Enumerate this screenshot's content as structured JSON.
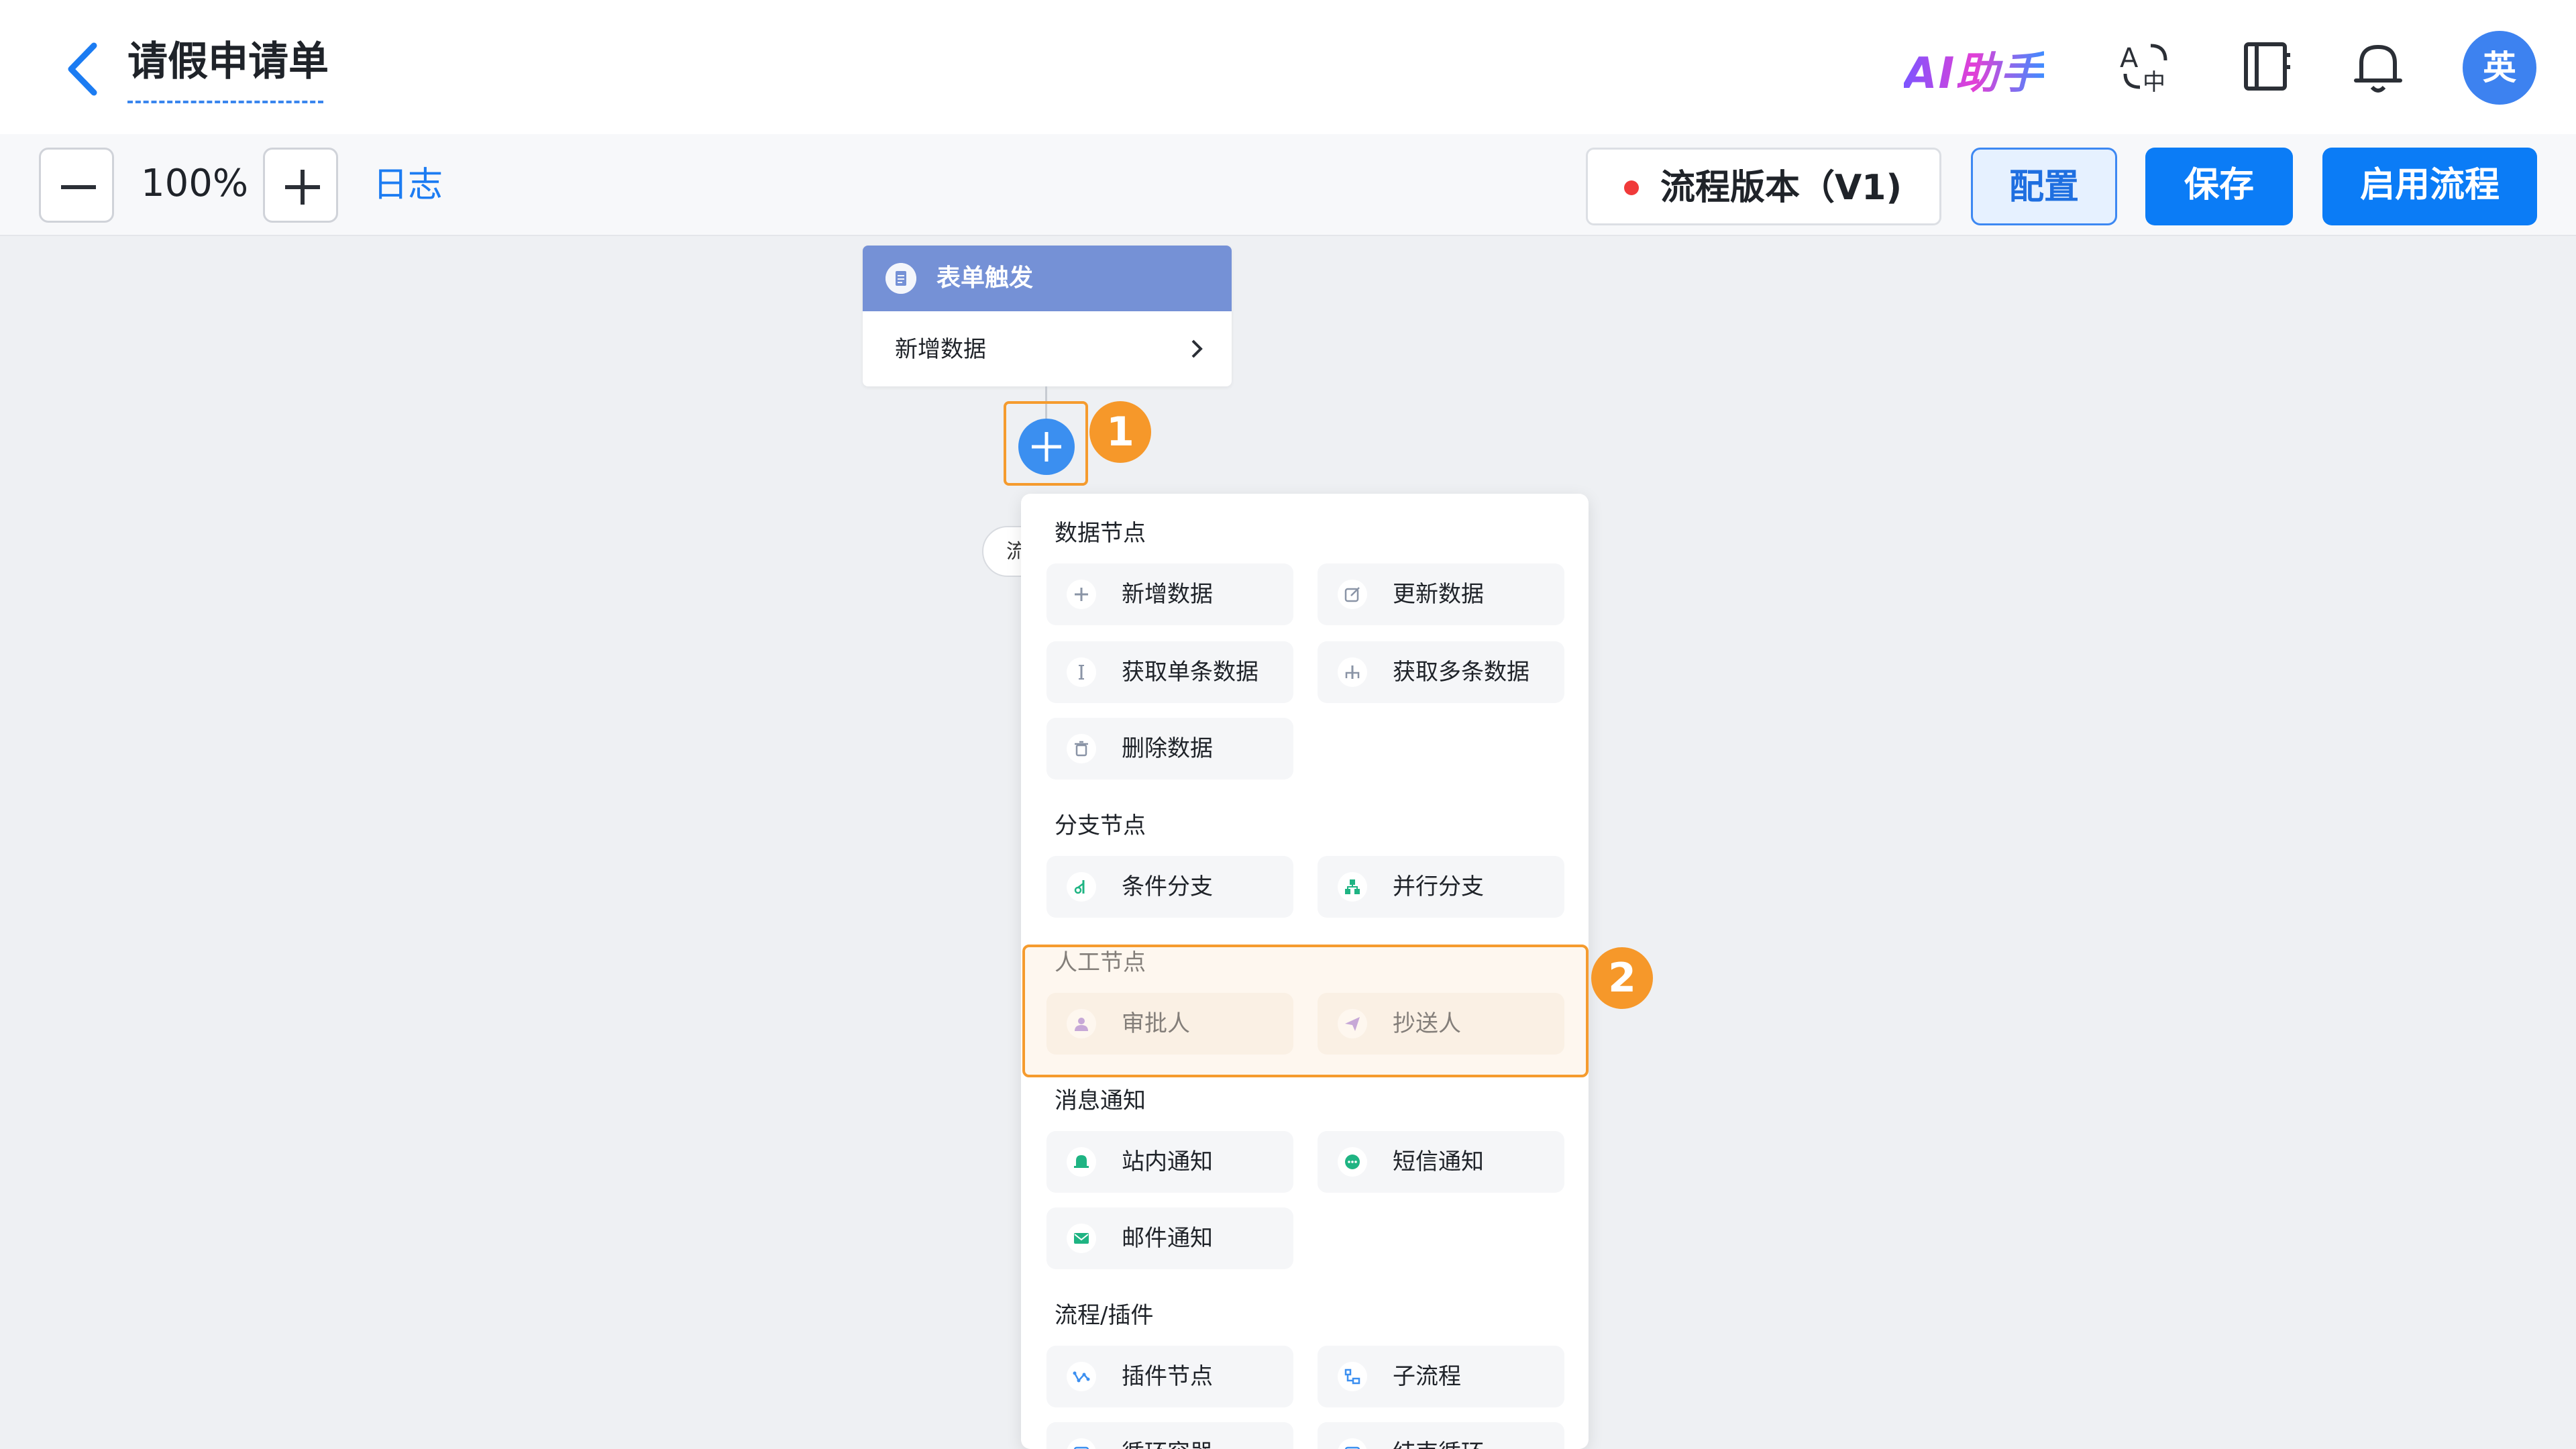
{
  "header": {
    "title": "请假申请单",
    "ai_label": "AI助手",
    "avatar_text": "英"
  },
  "toolbar": {
    "zoom_level": "100%",
    "log_label": "日志",
    "version_label": "流程版本（V1)",
    "config_label": "配置",
    "save_label": "保存",
    "enable_label": "启用流程"
  },
  "canvas": {
    "trigger_title": "表单触发",
    "trigger_action": "新增数据",
    "hidden_pill_text": "流",
    "callouts": [
      "1",
      "2"
    ]
  },
  "node_menu": {
    "sections": [
      {
        "title": "数据节点",
        "items": [
          "新增数据",
          "更新数据",
          "获取单条数据",
          "获取多条数据",
          "删除数据"
        ]
      },
      {
        "title": "分支节点",
        "items": [
          "条件分支",
          "并行分支"
        ]
      },
      {
        "title": "人工节点",
        "items": [
          "审批人",
          "抄送人"
        ]
      },
      {
        "title": "消息通知",
        "items": [
          "站内通知",
          "短信通知",
          "邮件通知"
        ]
      },
      {
        "title": "流程/插件",
        "items": [
          "插件节点",
          "子流程",
          "循环容器",
          "结束循环"
        ]
      }
    ]
  },
  "colors": {
    "primary": "#0b7cf6",
    "trigger_header": "#7591d6",
    "highlight": "#f59b2e",
    "manual_icon": "#9b6fd3",
    "notify_icon": "#1fb483"
  }
}
